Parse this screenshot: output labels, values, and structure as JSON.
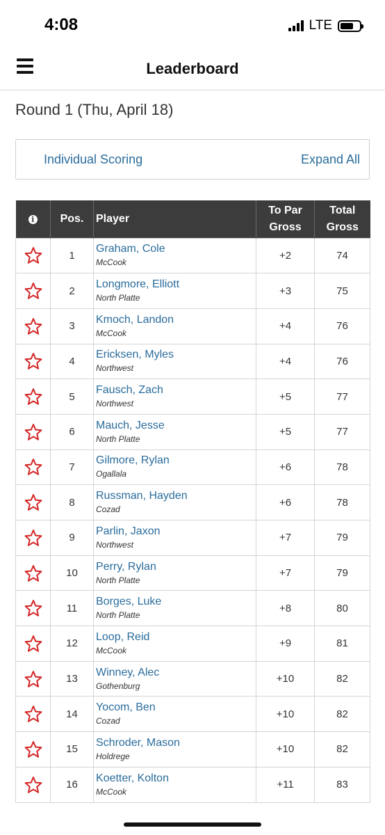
{
  "status": {
    "time": "4:08",
    "network": "LTE"
  },
  "nav": {
    "title": "Leaderboard",
    "menu_icon": "hamburger-menu-icon"
  },
  "round_title": "Round 1 (Thu, April 18)",
  "scoring": {
    "label": "Individual Scoring",
    "expand": "Expand All"
  },
  "table": {
    "headers": {
      "info": "i",
      "pos": "Pos.",
      "player": "Player",
      "topar_line1": "To Par",
      "topar_line2": "Gross",
      "total_line1": "Total",
      "total_line2": "Gross"
    },
    "rows": [
      {
        "pos": "1",
        "name": "Graham, Cole",
        "team": "McCook",
        "to_par": "+2",
        "total": "74"
      },
      {
        "pos": "2",
        "name": "Longmore, Elliott",
        "team": "North Platte",
        "to_par": "+3",
        "total": "75"
      },
      {
        "pos": "3",
        "name": "Kmoch, Landon",
        "team": "McCook",
        "to_par": "+4",
        "total": "76"
      },
      {
        "pos": "4",
        "name": "Ericksen, Myles",
        "team": "Northwest",
        "to_par": "+4",
        "total": "76"
      },
      {
        "pos": "5",
        "name": "Fausch, Zach",
        "team": "Northwest",
        "to_par": "+5",
        "total": "77"
      },
      {
        "pos": "6",
        "name": "Mauch, Jesse",
        "team": "North Platte",
        "to_par": "+5",
        "total": "77"
      },
      {
        "pos": "7",
        "name": "Gilmore, Rylan",
        "team": "Ogallala",
        "to_par": "+6",
        "total": "78"
      },
      {
        "pos": "8",
        "name": "Russman, Hayden",
        "team": "Cozad",
        "to_par": "+6",
        "total": "78"
      },
      {
        "pos": "9",
        "name": "Parlin, Jaxon",
        "team": "Northwest",
        "to_par": "+7",
        "total": "79"
      },
      {
        "pos": "10",
        "name": "Perry, Rylan",
        "team": "North Platte",
        "to_par": "+7",
        "total": "79"
      },
      {
        "pos": "11",
        "name": "Borges, Luke",
        "team": "North Platte",
        "to_par": "+8",
        "total": "80"
      },
      {
        "pos": "12",
        "name": "Loop, Reid",
        "team": "McCook",
        "to_par": "+9",
        "total": "81"
      },
      {
        "pos": "13",
        "name": "Winney, Alec",
        "team": "Gothenburg",
        "to_par": "+10",
        "total": "82"
      },
      {
        "pos": "14",
        "name": "Yocom, Ben",
        "team": "Cozad",
        "to_par": "+10",
        "total": "82"
      },
      {
        "pos": "15",
        "name": "Schroder, Mason",
        "team": "Holdrege",
        "to_par": "+10",
        "total": "82"
      },
      {
        "pos": "16",
        "name": "Koetter, Kolton",
        "team": "McCook",
        "to_par": "+11",
        "total": "83"
      }
    ]
  },
  "colors": {
    "link": "#2a6c9c",
    "header_bg": "#3c3c3c",
    "star": "#d42424"
  }
}
